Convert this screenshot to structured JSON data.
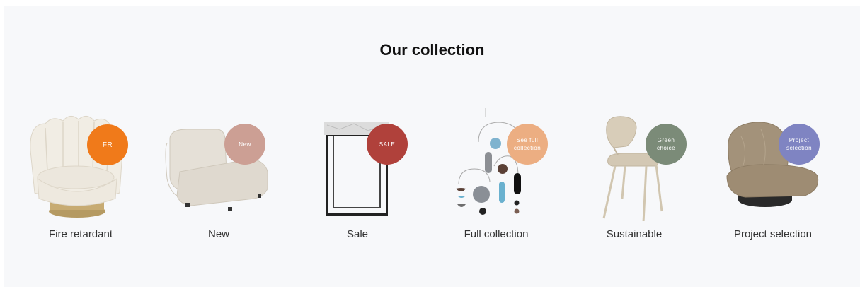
{
  "section": {
    "title": "Our collection"
  },
  "categories": [
    {
      "label": "Fire retardant",
      "badge": "FR",
      "badge_color": "#f07a1a",
      "product": "scalloped armchair"
    },
    {
      "label": "New",
      "badge": "New",
      "badge_color": "#cc9f94",
      "product": "boucle lounge chair"
    },
    {
      "label": "Sale",
      "badge": "SALE",
      "badge_color": "#b0413b",
      "product": "marble side table"
    },
    {
      "label": "Full collection",
      "badge": "See full\ncollection",
      "badge_color": "#ecae82",
      "product": "decorative mobile"
    },
    {
      "label": "Sustainable",
      "badge": "Green\nchoice",
      "badge_color": "#7b8b78",
      "product": "dining chair"
    },
    {
      "label": "Project selection",
      "badge": "Project\nselection",
      "badge_color": "#7f84c2",
      "product": "velvet swivel chair"
    }
  ]
}
